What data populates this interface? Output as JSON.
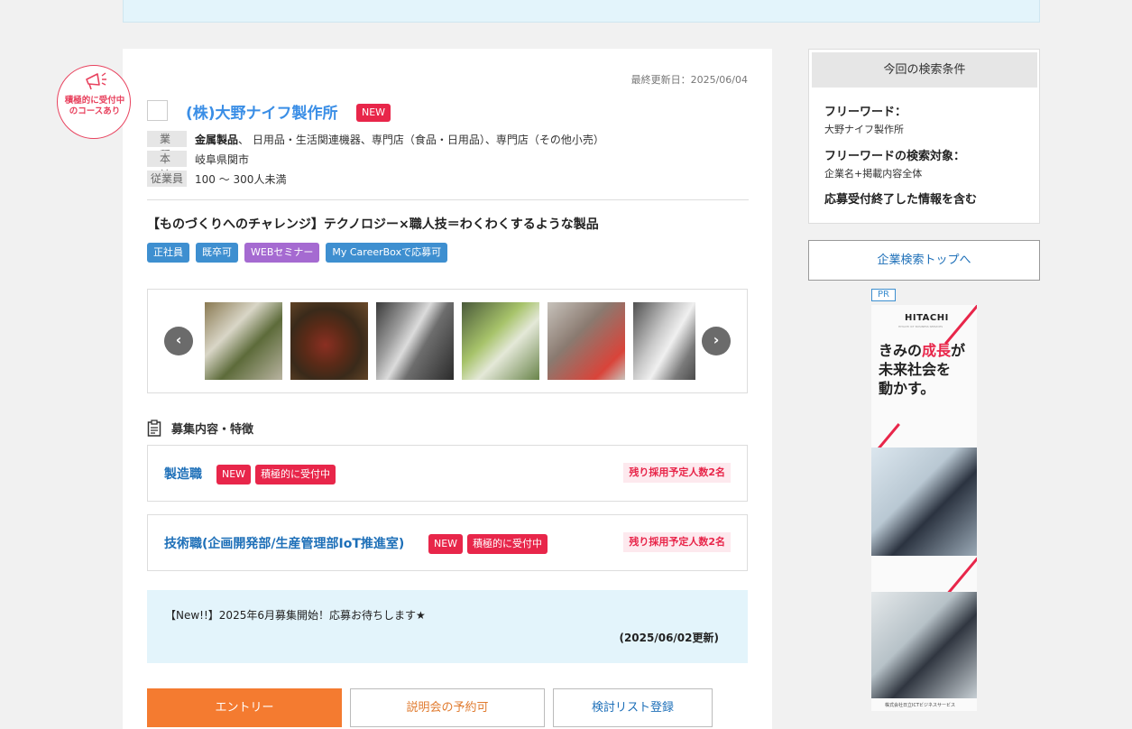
{
  "stamp": {
    "text": "積極的に受付中のコースあり"
  },
  "company": {
    "last_updated": "最終更新日：2025/06/04",
    "name": "(株)大野ナイフ製作所",
    "new_label": "NEW",
    "industry_label": "業　種",
    "industry_main": "金属製品",
    "industry_rest": " 、 日用品・生活関連機器、専門店（食品・日用品）、専門店（その他小売）",
    "hq_label": "本　社",
    "hq_value": "岐阜県関市",
    "employees_label": "従業員",
    "employees_value": "100 〜 300人未満",
    "catchphrase": "【ものづくりへのチャレンジ】テクノロジー×職人技＝わくわくするような製品",
    "tags": [
      "正社員",
      "既卒可",
      "WEBセミナー",
      "My CareerBoxで応募可"
    ]
  },
  "gallery": {
    "prev": "‹",
    "next": "›"
  },
  "recruit": {
    "heading": "募集内容・特徴",
    "jobs": [
      {
        "title": "製造職",
        "badge_new": "NEW",
        "badge_active": "積極的に受付中",
        "remaining": "残り採用予定人数2名"
      },
      {
        "title": "技術職(企画開発部/生産管理部IoT推進室)",
        "badge_new": "NEW",
        "badge_active": "積極的に受付中",
        "remaining": "残り採用予定人数2名"
      }
    ]
  },
  "notice": {
    "text": "【New!!】2025年6月募集開始！応募お待ちします★",
    "date": "(2025/06/02更新)"
  },
  "actions": {
    "entry": "エントリー",
    "seminar": "説明会の予約可",
    "list": "検討リスト登録"
  },
  "search_conditions": {
    "title": "今回の検索条件",
    "freeword_label": "フリーワード：",
    "freeword_value": "大野ナイフ製作所",
    "target_label": "フリーワードの検索対象：",
    "target_value": "企業名+掲載内容全体",
    "include_closed": "応募受付終了した情報を含む"
  },
  "top_link": "企業検索トップへ",
  "ad": {
    "pr": "PR",
    "logo": "HITACHI",
    "sub": "HITACHI ICT BUSINESS SERVICES",
    "copy_1": "きみの",
    "copy_hl": "成長",
    "copy_2": "が",
    "copy_3": "未来社会を",
    "copy_4": "動かす。",
    "footer": "株式会社日立ICTビジネスサービス"
  }
}
